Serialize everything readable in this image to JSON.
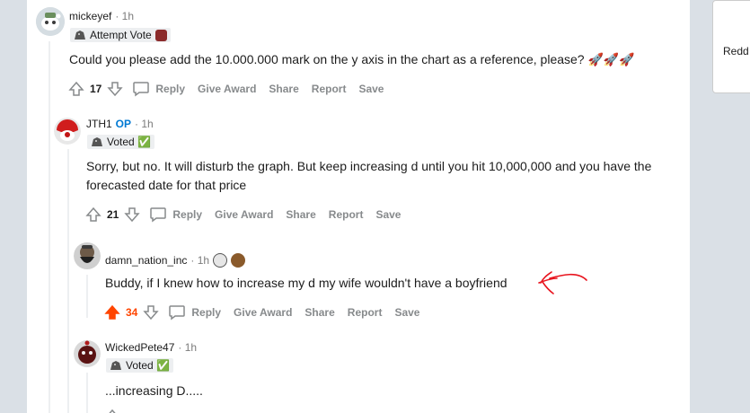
{
  "sidebar": {
    "partial_text": "Redd"
  },
  "comments": [
    {
      "user": "mickeyef",
      "time": "· 1h",
      "flair": "Attempt Vote",
      "body": "Could you please add the 10.000.000 mark on the y axis in the chart as a reference, please? 🚀🚀🚀",
      "score": "17",
      "actions": {
        "reply": "Reply",
        "award": "Give Award",
        "share": "Share",
        "report": "Report",
        "save": "Save"
      }
    },
    {
      "user": "JTH1",
      "op": "OP",
      "time": "· 1h",
      "flair": "Voted ✅",
      "body": "Sorry, but no. It will disturb the graph. But keep increasing d until you hit 10,000,000 and you have the forecasted date for that price",
      "score": "21",
      "actions": {
        "reply": "Reply",
        "award": "Give Award",
        "share": "Share",
        "report": "Report",
        "save": "Save"
      }
    },
    {
      "user": "damn_nation_inc",
      "time": "· 1h",
      "body": "Buddy, if I knew how to increase my d my wife wouldn't have a boyfriend",
      "score": "34",
      "actions": {
        "reply": "Reply",
        "award": "Give Award",
        "share": "Share",
        "report": "Report",
        "save": "Save"
      }
    },
    {
      "user": "WickedPete47",
      "time": "· 1h",
      "flair": "Voted ✅",
      "body": "...increasing D....."
    }
  ],
  "colors": {
    "upvote_active": "#ff4500",
    "meta_gray": "#878a8c",
    "op_blue": "#0079d3",
    "annotation_red": "#e8141e"
  }
}
